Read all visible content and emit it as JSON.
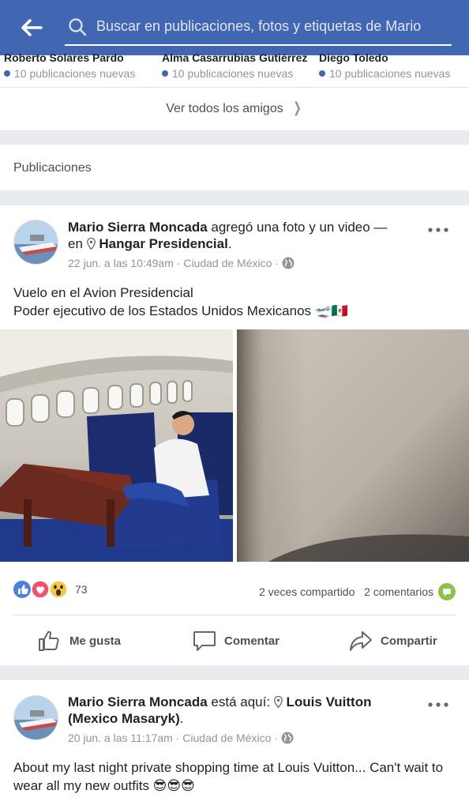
{
  "header": {
    "search_placeholder": "Buscar en publicaciones, fotos y etiquetas de Mario"
  },
  "friends": {
    "items": [
      {
        "name": "Roberto Solares Pardo",
        "status": "10 publicaciones nuevas"
      },
      {
        "name": "Alma Casarrubias Gutiérrez",
        "status": "10 publicaciones nuevas"
      },
      {
        "name": "Diego Toledo",
        "status": "10 publicaciones nuevas"
      }
    ],
    "see_all": "Ver todos los amigos"
  },
  "section": {
    "title": "Publicaciones"
  },
  "posts": [
    {
      "author": "Mario Sierra Moncada",
      "action": " agregó una foto y un video — en ",
      "place": "Hangar Presidencial",
      "place_suffix": ".",
      "date": "22 jun. a las 10:49am",
      "sep": " · ",
      "location": "Ciudad de México",
      "text_line1": "Vuelo en el Avion Presidencial",
      "text_line2": "Poder ejecutivo de los Estados Unidos Mexicanos 🛫🇲🇽",
      "reactions_count": "73",
      "shares": "2 veces compartido",
      "comments": "2 comentarios",
      "actions": {
        "like": "Me gusta",
        "comment": "Comentar",
        "share": "Compartir"
      }
    },
    {
      "author": "Mario Sierra Moncada",
      "action": " está aquí: ",
      "place": "Louis Vuitton (Mexico Masaryk)",
      "place_suffix": ".",
      "date": "20 jun. a las 11:17am",
      "sep": " · ",
      "location": "Ciudad de México",
      "text_line1": "About my last night private shopping time at Louis Vuitton... Can't wait to wear all my new outfits 😎😎😎"
    }
  ],
  "colors": {
    "brand": "#4267b2",
    "link_gray": "#90949c",
    "comment_badge": "#8bc34a"
  }
}
